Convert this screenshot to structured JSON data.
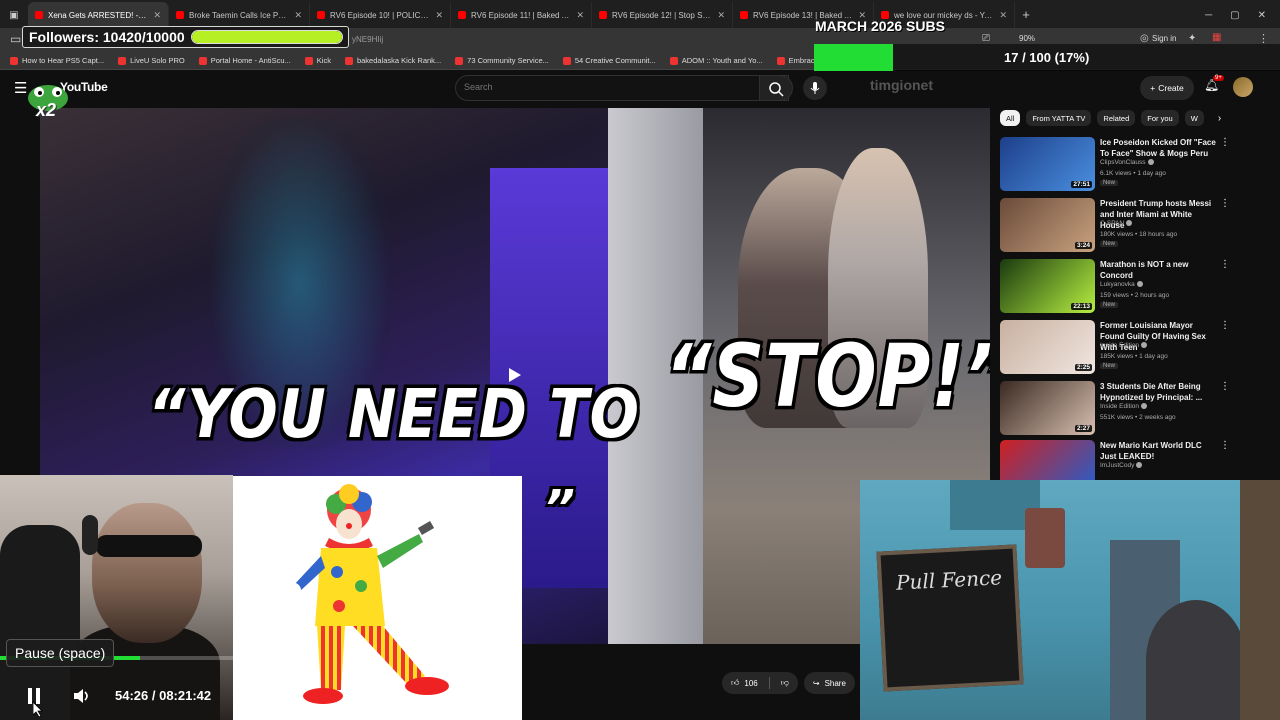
{
  "browser": {
    "tabs": [
      {
        "label": "Xena Gets ARRESTED! - Dr",
        "active": true
      },
      {
        "label": "Broke Taemin Calls Ice Poseidon"
      },
      {
        "label": "RV6 Episode 10! | POLICE Called"
      },
      {
        "label": "RV6 Episode 11! | Baked Alaska"
      },
      {
        "label": "RV6 Episode 12! | Stop Speeding"
      },
      {
        "label": "RV6 Episode 13! | Baked Alaska"
      },
      {
        "label": "we love our mickey ds - YouTube"
      }
    ],
    "url_fragment": "yNE9HIij",
    "zoom": "90%",
    "signin": "Sign in",
    "bookmarks": [
      "How to Hear PS5 Capt...",
      "LiveU Solo PRO",
      "Portal Home - AntiScu...",
      "Kick",
      "bakedalaska Kick Rank...",
      "73 Community Service...",
      "54 Creative Communit...",
      "ADOM :: Youth and Yo...",
      "Embracing the Cross a..."
    ]
  },
  "youtube": {
    "logo": "YouTube",
    "search_placeholder": "Search",
    "create_label": "Create",
    "notification_badge": "9+",
    "channel_ghost": "timgionet",
    "video_progress": 0.04,
    "captions": {
      "line1": "“YOU NEED TO",
      "line2": "“STOP!”",
      "line3": "C",
      "line4": "”"
    },
    "actions": {
      "likes": "106",
      "share": "Share"
    },
    "chips": [
      "All",
      "From YATTA TV",
      "Related",
      "For you",
      "W"
    ],
    "recommendations": [
      {
        "title": "Ice Poseidon Kicked Off \"Face To Face\" Show & Mogs Peru",
        "channel": "ClipsVonClauss",
        "meta": "6.1K views • 1 day ago",
        "badge": "New",
        "duration": "27:51",
        "colors": [
          "#1d3f8a",
          "#4a8fe0"
        ]
      },
      {
        "title": "President Trump hosts Messi and Inter Miami at White House",
        "channel": "C-SPAN",
        "meta": "180K views • 18 hours ago",
        "badge": "New",
        "duration": "3:24",
        "colors": [
          "#6a4a3a",
          "#c9a27e"
        ]
      },
      {
        "title": "Marathon is NOT a new Concord",
        "channel": "Lukyanovka",
        "meta": "159 views • 2 hours ago",
        "badge": "New",
        "duration": "22:13",
        "colors": [
          "#1a3a10",
          "#b6f040"
        ]
      },
      {
        "title": "Former Louisiana Mayor Found Guilty Of Having Sex With Teen",
        "channel": "Inside Edition",
        "meta": "185K views • 1 day ago",
        "badge": "New",
        "duration": "2:25",
        "colors": [
          "#c8b0a0",
          "#f0e6e0"
        ]
      },
      {
        "title": "3 Students Die After Being Hypnotized by Principal: ...",
        "channel": "Inside Edition",
        "meta": "551K views • 2 weeks ago",
        "badge": "",
        "duration": "2:27",
        "colors": [
          "#3a2a22",
          "#d8c0b0"
        ]
      },
      {
        "title": "New Mario Kart World DLC Just LEAKED!",
        "channel": "ImJustCody",
        "meta": "",
        "badge": "",
        "duration": "",
        "colors": [
          "#d02020",
          "#2060d0"
        ]
      }
    ]
  },
  "overlay": {
    "followers_label": "Followers: 10420/10000",
    "followers_progress": 1.0,
    "subs_title": "MARCH 2026 SUBS",
    "subs_label": "17 / 100 (17%)",
    "subs_progress": 0.17,
    "kick_badge": "x2",
    "chalkboard_text": "Pull Fence",
    "tooltip": "Pause (space)",
    "player_time": "54:26 / 08:21:42",
    "stream_progress": 0.6
  },
  "colors": {
    "yt_red": "#ff0000",
    "followers_fill": "#b6f024",
    "subs_fill": "#22dd33"
  }
}
